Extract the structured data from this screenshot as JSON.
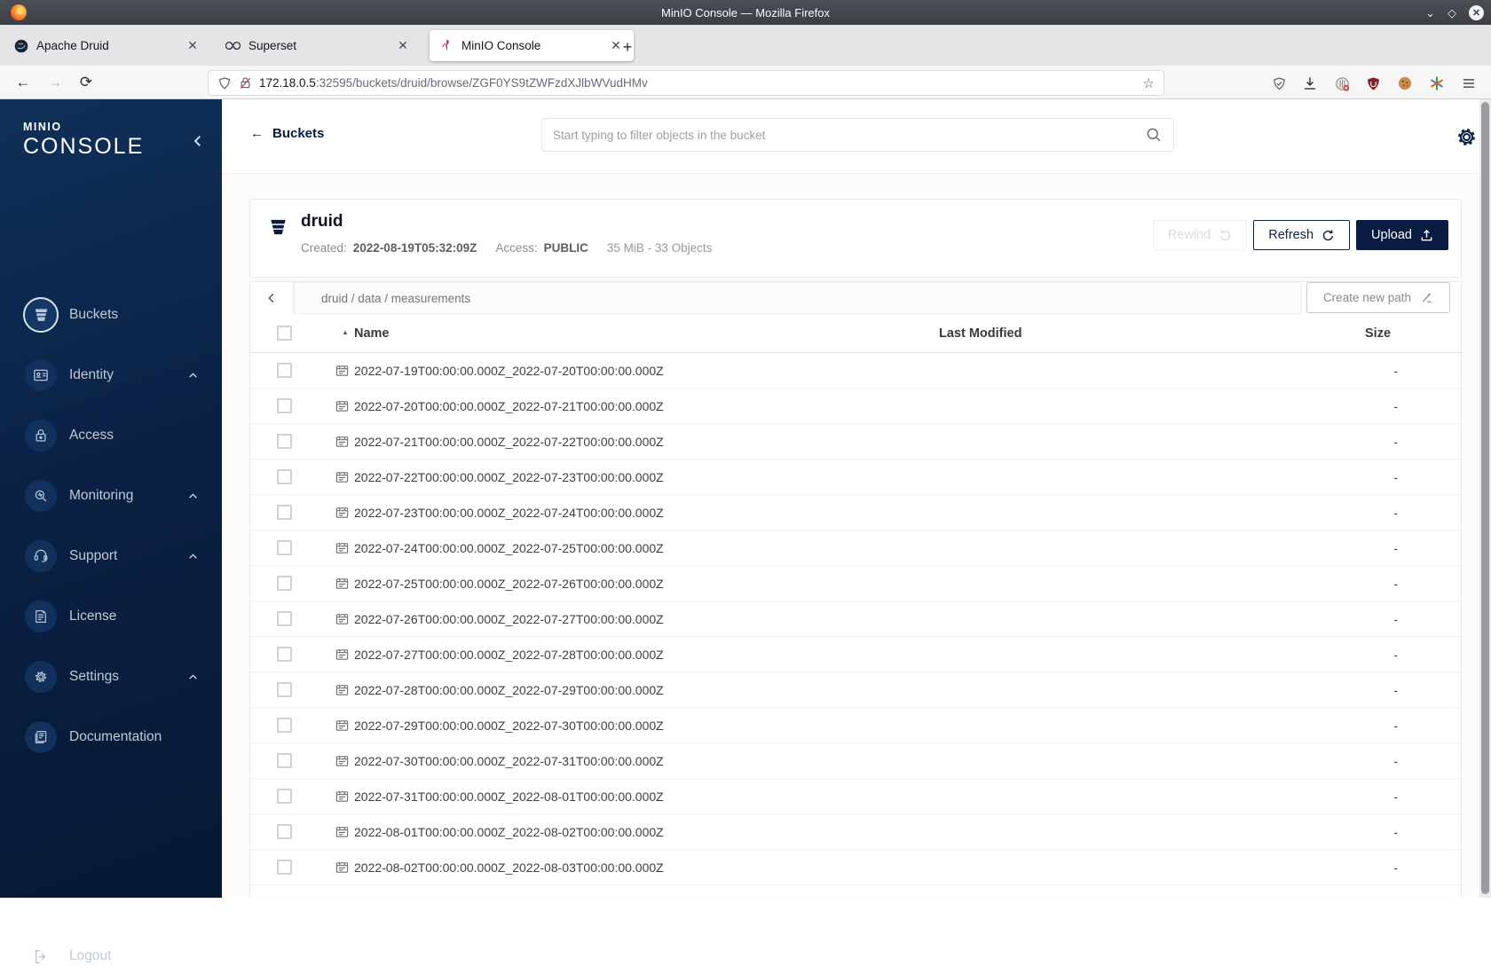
{
  "window": {
    "title": "MinIO Console — Mozilla Firefox"
  },
  "browser": {
    "tabs": [
      {
        "label": "Apache Druid",
        "favicon": "druid",
        "active": false
      },
      {
        "label": "Superset",
        "favicon": "superset",
        "active": false
      },
      {
        "label": "MinIO Console",
        "favicon": "minio",
        "active": true
      }
    ],
    "url": {
      "domain": "172.18.0.5",
      "rest": ":32595/buckets/druid/browse/ZGF0YS9tZWFzdXJlbWVudHMv"
    },
    "toolbar_icons": [
      "shield-check",
      "download",
      "extension-disabled",
      "ublock",
      "cookie",
      "colorful-asterisk",
      "menu"
    ]
  },
  "sidebar": {
    "logo_top": "MINIO",
    "logo_main": "CONSOLE",
    "items": [
      {
        "label": "Buckets",
        "icon": "bucket",
        "active": true,
        "expandable": false
      },
      {
        "label": "Identity",
        "icon": "identity",
        "active": false,
        "expandable": true
      },
      {
        "label": "Access",
        "icon": "lock",
        "active": false,
        "expandable": false
      },
      {
        "label": "Monitoring",
        "icon": "monitoring",
        "active": false,
        "expandable": true
      },
      {
        "label": "Support",
        "icon": "support",
        "active": false,
        "expandable": true
      },
      {
        "label": "License",
        "icon": "license",
        "active": false,
        "expandable": false
      },
      {
        "label": "Settings",
        "icon": "gear",
        "active": false,
        "expandable": true
      },
      {
        "label": "Documentation",
        "icon": "documentation",
        "active": false,
        "expandable": false
      }
    ],
    "logout_label": "Logout"
  },
  "header": {
    "back_label": "Buckets",
    "search_placeholder": "Start typing to filter objects in the bucket"
  },
  "bucket": {
    "name": "druid",
    "created_label": "Created:",
    "created": "2022-08-19T05:32:09Z",
    "access_label": "Access:",
    "access": "PUBLIC",
    "summary": "35 MiB - 33 Objects",
    "actions": {
      "rewind": "Rewind",
      "refresh": "Refresh",
      "upload": "Upload"
    }
  },
  "browse": {
    "breadcrumb": "druid / data / measurements",
    "create_path_label": "Create new path",
    "columns": {
      "name": "Name",
      "last_modified": "Last Modified",
      "size": "Size"
    },
    "rows": [
      {
        "name": "2022-07-19T00:00:00.000Z_2022-07-20T00:00:00.000Z",
        "last_modified": "",
        "size": "-"
      },
      {
        "name": "2022-07-20T00:00:00.000Z_2022-07-21T00:00:00.000Z",
        "last_modified": "",
        "size": "-"
      },
      {
        "name": "2022-07-21T00:00:00.000Z_2022-07-22T00:00:00.000Z",
        "last_modified": "",
        "size": "-"
      },
      {
        "name": "2022-07-22T00:00:00.000Z_2022-07-23T00:00:00.000Z",
        "last_modified": "",
        "size": "-"
      },
      {
        "name": "2022-07-23T00:00:00.000Z_2022-07-24T00:00:00.000Z",
        "last_modified": "",
        "size": "-"
      },
      {
        "name": "2022-07-24T00:00:00.000Z_2022-07-25T00:00:00.000Z",
        "last_modified": "",
        "size": "-"
      },
      {
        "name": "2022-07-25T00:00:00.000Z_2022-07-26T00:00:00.000Z",
        "last_modified": "",
        "size": "-"
      },
      {
        "name": "2022-07-26T00:00:00.000Z_2022-07-27T00:00:00.000Z",
        "last_modified": "",
        "size": "-"
      },
      {
        "name": "2022-07-27T00:00:00.000Z_2022-07-28T00:00:00.000Z",
        "last_modified": "",
        "size": "-"
      },
      {
        "name": "2022-07-28T00:00:00.000Z_2022-07-29T00:00:00.000Z",
        "last_modified": "",
        "size": "-"
      },
      {
        "name": "2022-07-29T00:00:00.000Z_2022-07-30T00:00:00.000Z",
        "last_modified": "",
        "size": "-"
      },
      {
        "name": "2022-07-30T00:00:00.000Z_2022-07-31T00:00:00.000Z",
        "last_modified": "",
        "size": "-"
      },
      {
        "name": "2022-07-31T00:00:00.000Z_2022-08-01T00:00:00.000Z",
        "last_modified": "",
        "size": "-"
      },
      {
        "name": "2022-08-01T00:00:00.000Z_2022-08-02T00:00:00.000Z",
        "last_modified": "",
        "size": "-"
      },
      {
        "name": "2022-08-02T00:00:00.000Z_2022-08-03T00:00:00.000Z",
        "last_modified": "",
        "size": "-"
      }
    ]
  },
  "colors": {
    "navy": "#081C42",
    "sidebar_top": "#103059",
    "sidebar_bottom": "#071832",
    "accent_red": "#c72c48"
  }
}
